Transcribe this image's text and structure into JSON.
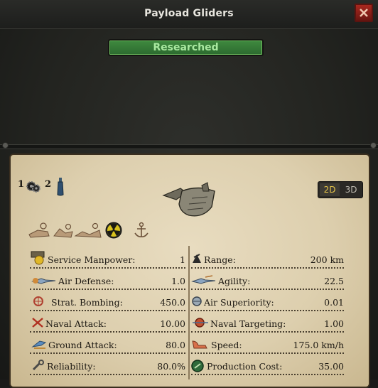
{
  "window": {
    "title": "Payload Gliders",
    "status_button": "Researched"
  },
  "colors": {
    "accent_green": "#3f8a3f",
    "close_red": "#a8281f",
    "paper": "#ddcfae"
  },
  "stack": [
    {
      "count": "1",
      "icon": "gear-cluster-icon"
    },
    {
      "count": "2",
      "icon": "bottle-icon"
    }
  ],
  "view_toggle": {
    "2d": "2D",
    "3d": "3D",
    "selected": "2D"
  },
  "abilities": [
    "airdrop-icon",
    "glider-icon",
    "glider-landing-icon",
    "radiation-icon",
    "anchor-icon"
  ],
  "stats_left": [
    {
      "label": "Service Manpower:",
      "value": "1",
      "icon": "manpower-icon"
    },
    {
      "label": "Air Defense:",
      "value": "1.0",
      "icon": "air-defense-icon"
    },
    {
      "label": "Strat. Bombing:",
      "value": "450.0",
      "icon": "strategic-bombing-icon"
    },
    {
      "label": "Naval Attack:",
      "value": "10.00",
      "icon": "naval-attack-icon"
    },
    {
      "label": "Ground Attack:",
      "value": "80.0",
      "icon": "ground-attack-icon"
    },
    {
      "label": "Reliability:",
      "value": "80.0%",
      "icon": "wrench-icon"
    }
  ],
  "stats_right": [
    {
      "label": "Range:",
      "value": "200 km",
      "icon": "range-icon"
    },
    {
      "label": "Agility:",
      "value": "22.5",
      "icon": "agility-icon"
    },
    {
      "label": "Air Superiority:",
      "value": "0.01",
      "icon": "air-superiority-icon"
    },
    {
      "label": "Naval Targeting:",
      "value": "1.00",
      "icon": "naval-targeting-icon"
    },
    {
      "label": "Speed:",
      "value": "175.0 km/h",
      "icon": "speed-icon"
    },
    {
      "label": "Production Cost:",
      "value": "35.00",
      "icon": "production-cost-icon"
    }
  ]
}
